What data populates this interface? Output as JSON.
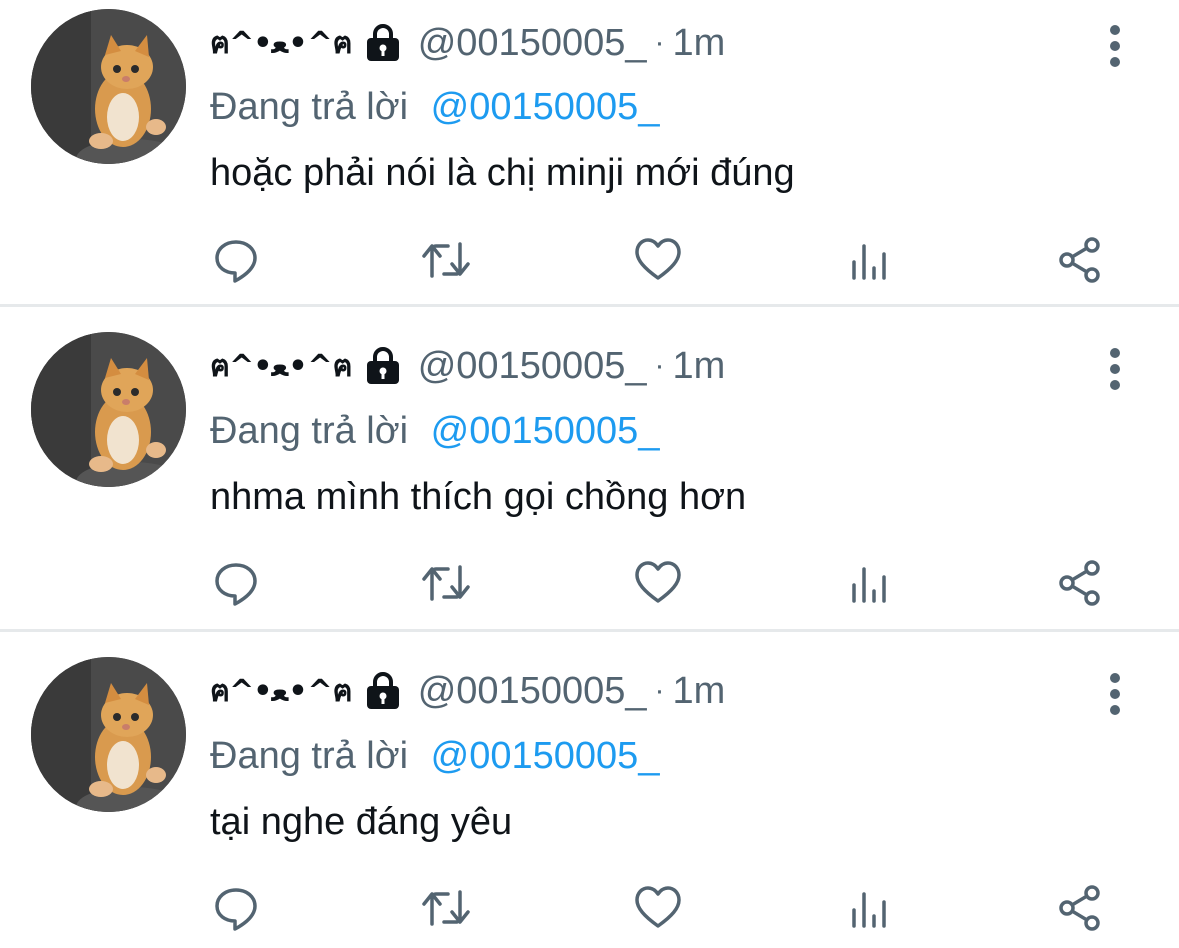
{
  "tweets": [
    {
      "display_name": "ฅ^•ﻌ•^ฅ",
      "handle": "@00150005_",
      "separator": "·",
      "time": "1m",
      "reply_prefix": "Đang trả lời",
      "reply_to": "@00150005_",
      "text": "hoặc phải nói là chị minji mới đúng"
    },
    {
      "display_name": "ฅ^•ﻌ•^ฅ",
      "handle": "@00150005_",
      "separator": "·",
      "time": "1m",
      "reply_prefix": "Đang trả lời",
      "reply_to": "@00150005_",
      "text": "nhma mình thích gọi chồng hơn"
    },
    {
      "display_name": "ฅ^•ﻌ•^ฅ",
      "handle": "@00150005_",
      "separator": "·",
      "time": "1m",
      "reply_prefix": "Đang trả lời",
      "reply_to": "@00150005_",
      "text": "tại nghe đáng yêu"
    }
  ],
  "icons": {
    "lock": "lock-icon",
    "more": "more-vertical-icon",
    "reply": "reply-icon",
    "retweet": "retweet-icon",
    "like": "heart-icon",
    "views": "views-icon",
    "share": "share-icon"
  },
  "colors": {
    "text_primary": "#0f1419",
    "text_secondary": "#536471",
    "mention": "#1d9bf0",
    "divider": "#e6e9eb"
  }
}
